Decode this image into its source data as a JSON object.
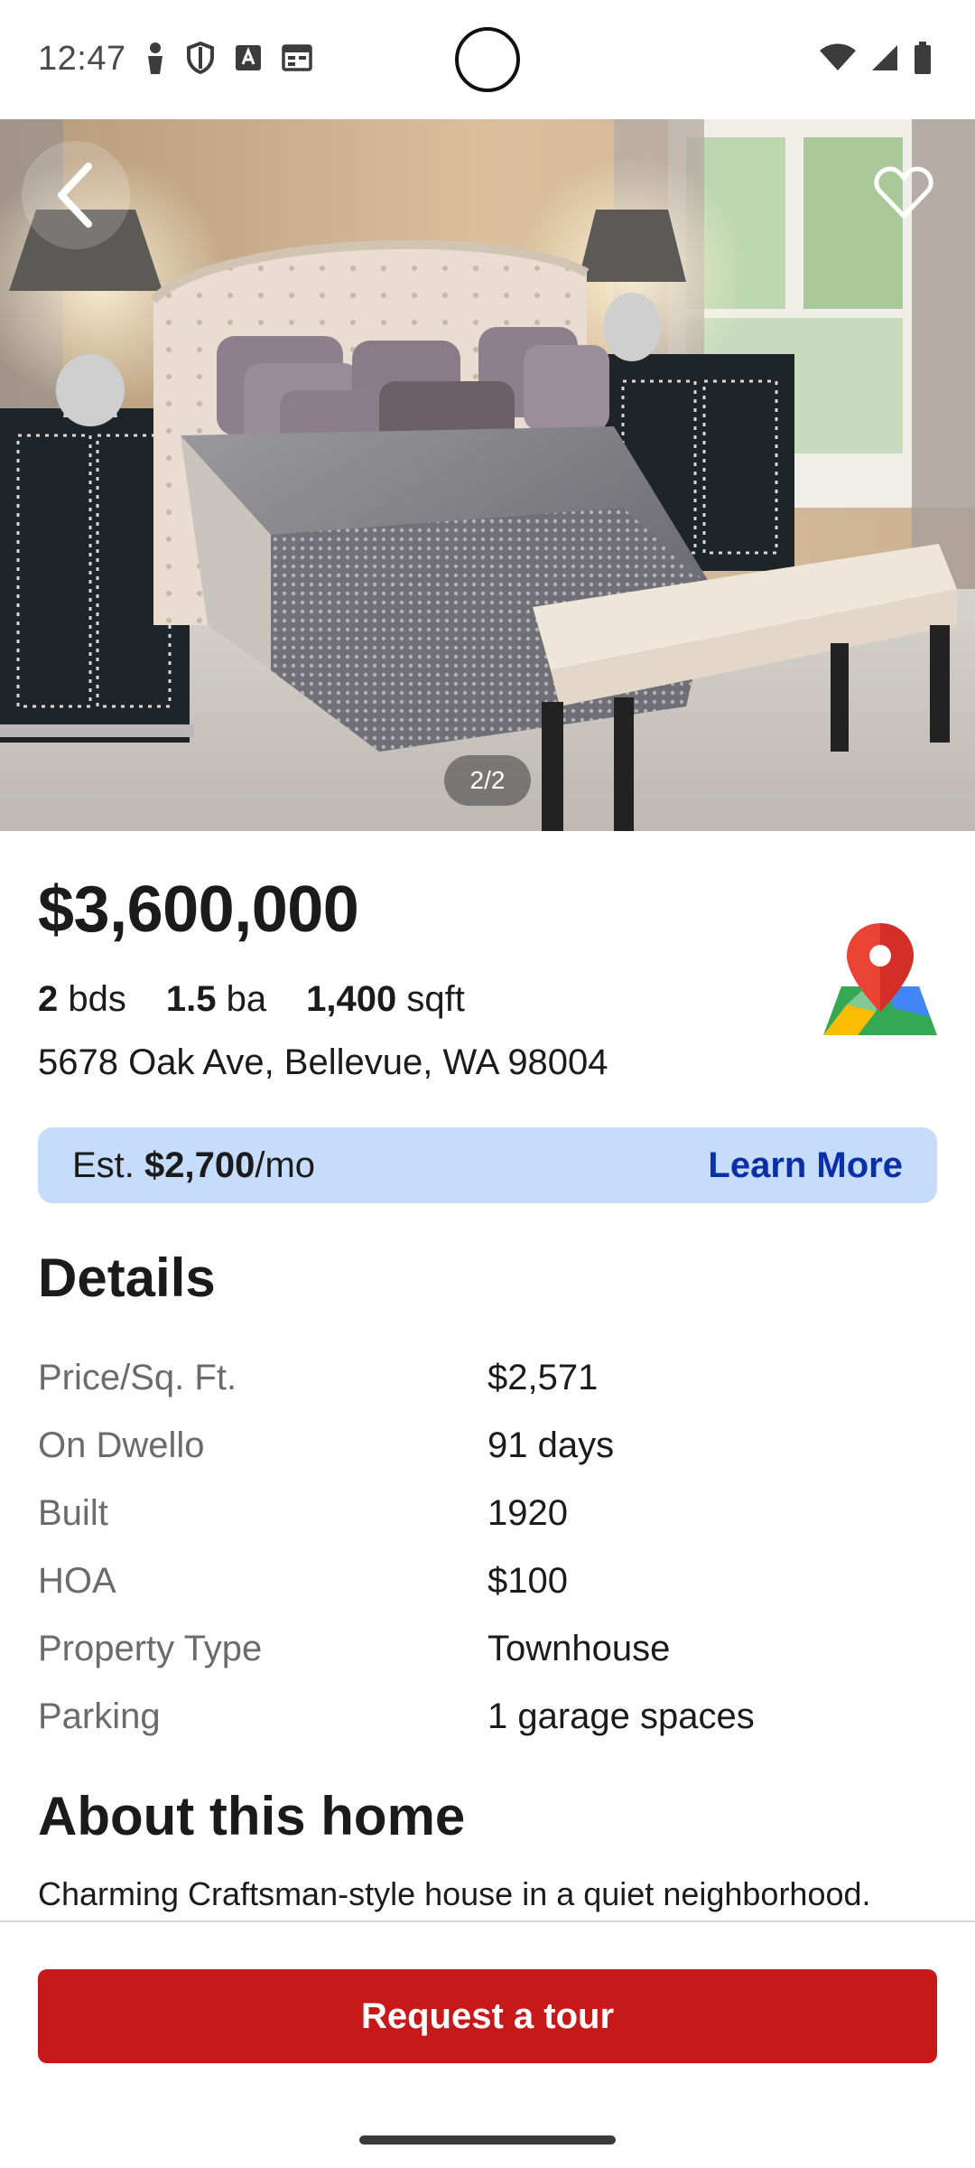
{
  "status_bar": {
    "time": "12:47",
    "left_icons": [
      "notification-person-icon",
      "shield-icon",
      "font-a-icon",
      "calendar-icon"
    ],
    "right_icons": [
      "wifi-icon",
      "signal-icon",
      "battery-icon"
    ]
  },
  "hero": {
    "photo_counter": "2/2",
    "back_icon": "chevron-left-icon",
    "favorite_icon": "heart-icon"
  },
  "listing": {
    "price": "$3,600,000",
    "beds_value": "2",
    "beds_unit": "bds",
    "baths_value": "1.5",
    "baths_unit": "ba",
    "sqft_value": "1,400",
    "sqft_unit": "sqft",
    "address": "5678 Oak Ave, Bellevue, WA 98004",
    "map_icon": "map-pin-icon"
  },
  "mortgage": {
    "prefix": "Est. ",
    "amount": "$2,700",
    "suffix": "/mo",
    "link_label": "Learn More"
  },
  "details": {
    "title": "Details",
    "rows": [
      {
        "label": "Price/Sq. Ft.",
        "value": "$2,571"
      },
      {
        "label": "On Dwello",
        "value": "91 days"
      },
      {
        "label": "Built",
        "value": "1920"
      },
      {
        "label": "HOA",
        "value": "$100"
      },
      {
        "label": "Property Type",
        "value": "Townhouse"
      },
      {
        "label": "Parking",
        "value": "1 garage spaces"
      }
    ]
  },
  "about": {
    "title": "About this home",
    "text": "Charming Craftsman-style house in a quiet neighborhood."
  },
  "actions": {
    "request_tour_label": "Request a tour"
  },
  "colors": {
    "accent_red": "#c8191a",
    "mortgage_bg": "#c5dcfb",
    "link_blue": "#0b2fa8"
  }
}
